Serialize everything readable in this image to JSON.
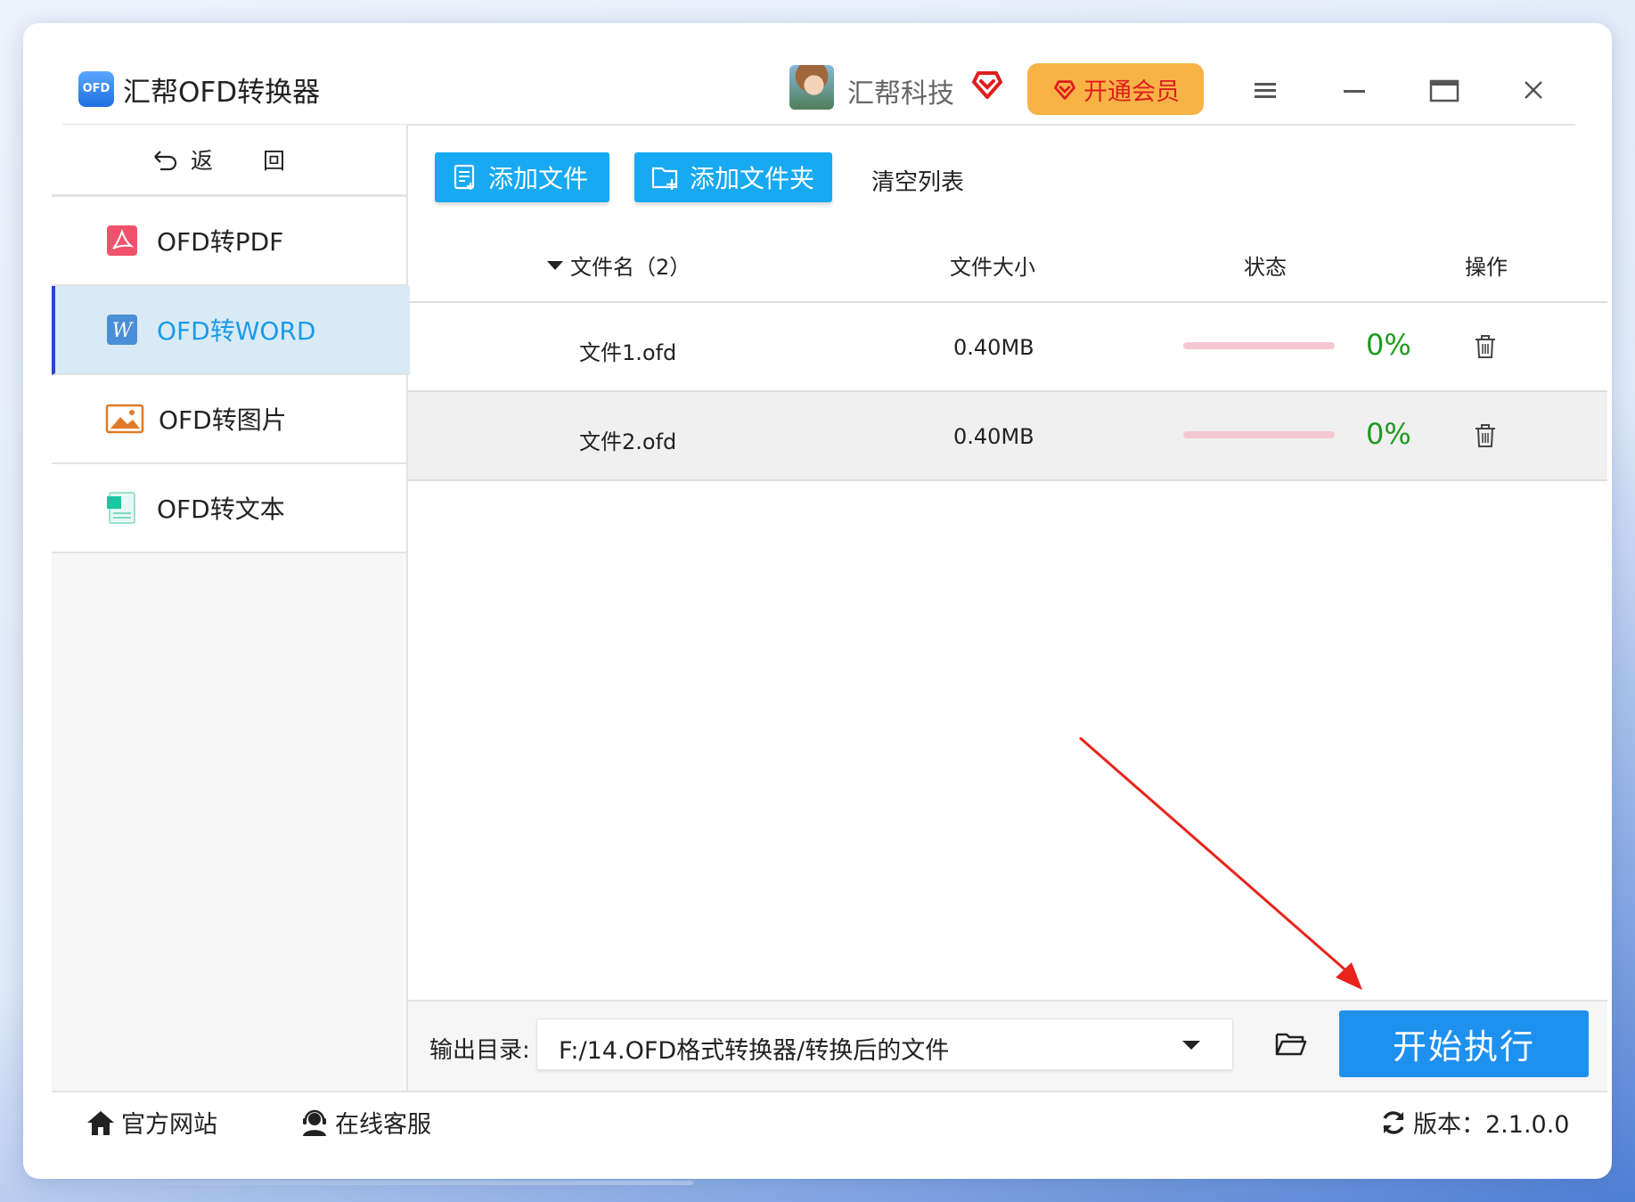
{
  "app": {
    "logo_text": "OFD",
    "title": "汇帮OFD转换器",
    "user_name": "汇帮科技",
    "vip_button": "开通会员",
    "colors": {
      "accent": "#17a9f2",
      "vip": "#f8b346",
      "vip_text": "#e01d1d",
      "success": "#1f9a1f"
    }
  },
  "sidebar": {
    "back_label": "返 回",
    "items": [
      {
        "label": "OFD转PDF",
        "icon": "pdf-icon",
        "active": false
      },
      {
        "label": "OFD转WORD",
        "icon": "word-icon",
        "active": true
      },
      {
        "label": "OFD转图片",
        "icon": "image-icon",
        "active": false
      },
      {
        "label": "OFD转文本",
        "icon": "text-file-icon",
        "active": false
      }
    ]
  },
  "toolbar": {
    "add_file": "添加文件",
    "add_folder": "添加文件夹",
    "clear_list": "清空列表"
  },
  "table": {
    "headers": {
      "name": "文件名（2）",
      "size": "文件大小",
      "status": "状态",
      "action": "操作"
    },
    "rows": [
      {
        "name": "文件1.ofd",
        "size": "0.40MB",
        "progress": 0,
        "percent": "0%"
      },
      {
        "name": "文件2.ofd",
        "size": "0.40MB",
        "progress": 0,
        "percent": "0%"
      }
    ]
  },
  "output": {
    "label": "输出目录:",
    "path": "F:/14.OFD格式转换器/转换后的文件",
    "start_button": "开始执行"
  },
  "footer": {
    "website": "官方网站",
    "support": "在线客服",
    "version": "版本：2.1.0.0"
  }
}
